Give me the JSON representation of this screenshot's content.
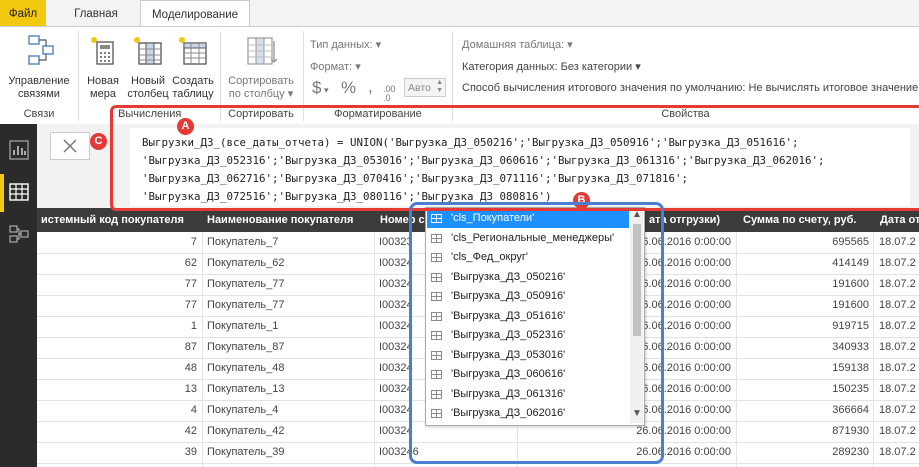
{
  "tabs": [
    "Файл",
    "Главная",
    "Моделирование"
  ],
  "ribbon": {
    "manage_relations": [
      "Управление",
      "связями"
    ],
    "new_measure": [
      "Новая",
      "мера"
    ],
    "new_column": [
      "Новый",
      "столбец"
    ],
    "new_table": [
      "Создать",
      "таблицу"
    ],
    "sort_by_column": [
      "Сортировать",
      "по столбцу"
    ],
    "data_type": "Тип данных:",
    "format": "Формат:",
    "auto": "Авто",
    "home_table": "Домашняя таблица:",
    "data_category": "Категория данных: Без категории",
    "summarization": "Способ вычисления итогового значения по умолчанию: Не вычислять итоговое значение",
    "groups": {
      "relations": "Связи",
      "calculations": "Вычисления",
      "sorting": "Сортировать",
      "formatting": "Форматирование",
      "properties": "Свойства"
    }
  },
  "formula": {
    "lines": [
      "Выгрузки_ДЗ_(все_даты_отчета) = UNION('Выгрузка_ДЗ_050216';'Выгрузка_ДЗ_050916';'Выгрузка_ДЗ_051616';",
      "'Выгрузка_ДЗ_052316';'Выгрузка_ДЗ_053016';'Выгрузка_ДЗ_060616';'Выгрузка_ДЗ_061316';'Выгрузка_ДЗ_062016';",
      "'Выгрузка_ДЗ_062716';'Выгрузка_ДЗ_070416';'Выгрузка_ДЗ_071116';'Выгрузка_ДЗ_071816';",
      "'Выгрузка_ДЗ_072516';'Выгрузка_ДЗ_080116';'Выгрузка_ДЗ_080816')"
    ]
  },
  "annotations": {
    "a": "A",
    "b": "B",
    "c": "C"
  },
  "grid": {
    "headers": [
      "истемный код покупателя",
      "Наименование покупателя",
      "Номер с",
      "ата отгрузки)",
      "Сумма по счету, руб.",
      "Дата от"
    ],
    "rows": [
      {
        "code": "7",
        "name": "Покупатель_7",
        "num": "I00323",
        "date": "26.06.2016 0:00:00",
        "sum": "695565",
        "d2": "18.07.2"
      },
      {
        "code": "62",
        "name": "Покупатель_62",
        "num": "I00324",
        "date": "26.06.2016 0:00:00",
        "sum": "414149",
        "d2": "18.07.2"
      },
      {
        "code": "77",
        "name": "Покупатель_77",
        "num": "I00324",
        "date": "26.06.2016 0:00:00",
        "sum": "191600",
        "d2": "18.07.2"
      },
      {
        "code": "77",
        "name": "Покупатель_77",
        "num": "I00324",
        "date": "26.06.2016 0:00:00",
        "sum": "191600",
        "d2": "18.07.2"
      },
      {
        "code": "1",
        "name": "Покупатель_1",
        "num": "I00324",
        "date": "26.06.2016 0:00:00",
        "sum": "919715",
        "d2": "18.07.2"
      },
      {
        "code": "87",
        "name": "Покупатель_87",
        "num": "I00324",
        "date": "26.06.2016 0:00:00",
        "sum": "340933",
        "d2": "18.07.2"
      },
      {
        "code": "48",
        "name": "Покупатель_48",
        "num": "I00324",
        "date": "26.06.2016 0:00:00",
        "sum": "159138",
        "d2": "18.07.2"
      },
      {
        "code": "13",
        "name": "Покупатель_13",
        "num": "I00324",
        "date": "26.06.2016 0:00:00",
        "sum": "150235",
        "d2": "18.07.2"
      },
      {
        "code": "4",
        "name": "Покупатель_4",
        "num": "I00324",
        "date": "26.06.2016 0:00:00",
        "sum": "366664",
        "d2": "18.07.2"
      },
      {
        "code": "42",
        "name": "Покупатель_42",
        "num": "I00324",
        "date": "26.06.2016 0:00:00",
        "sum": "871930",
        "d2": "18.07.2"
      },
      {
        "code": "39",
        "name": "Покупатель_39",
        "num": "I003246",
        "date": "26.06.2016 0:00:00",
        "sum": "289230",
        "d2": "18.07.2"
      }
    ]
  },
  "dropdown": {
    "items": [
      "'cls_Покупатели'",
      "'cls_Региональные_менеджеры'",
      "'cls_Фед_округ'",
      "'Выгрузка_ДЗ_050216'",
      "'Выгрузка_ДЗ_050916'",
      "'Выгрузка_ДЗ_051616'",
      "'Выгрузка_ДЗ_052316'",
      "'Выгрузка_ДЗ_053016'",
      "'Выгрузка_ДЗ_060616'",
      "'Выгрузка_ДЗ_061316'",
      "'Выгрузка_ДЗ_062016'"
    ],
    "selected_index": 0
  },
  "colors": {
    "accent": "#f2c811",
    "annotation_red": "#e53935",
    "annotation_blue": "#4a7fd0",
    "selection": "#1e90ff"
  }
}
